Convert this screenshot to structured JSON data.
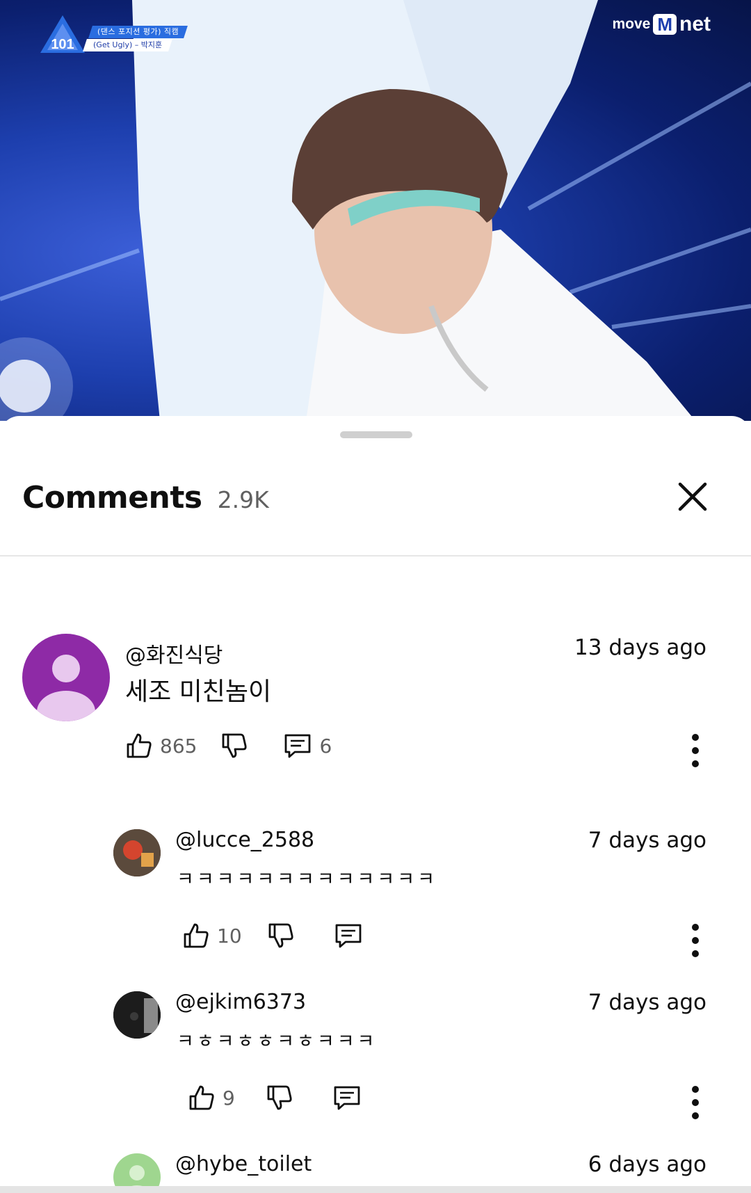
{
  "video": {
    "show_badge": "101",
    "caption_tag": "(댄스 포지션 평가) 직캠",
    "caption_sub": "(Get Ugly) – 박지훈",
    "brand_move": "move",
    "brand_m": "M",
    "brand_net": "net"
  },
  "comments_panel": {
    "title": "Comments",
    "count": "2.9K"
  },
  "comments": [
    {
      "user": "@화진식당",
      "time": "13 days ago",
      "text": "세조 미친놈이",
      "likes": "865",
      "replies": "6",
      "avatar_color": "#8e2aa6"
    },
    {
      "user": "@lucce_2588",
      "time": "7 days ago",
      "text": "ㅋㅋㅋㅋㅋㅋㅋㅋㅋㅋㅋㅋㅋ",
      "likes": "10",
      "replies": ""
    },
    {
      "user": "@ejkim6373",
      "time": "7 days ago",
      "text": "ㅋㅎㅋㅎㅎㅋㅎㅋㅋㅋ",
      "likes": "9",
      "replies": ""
    },
    {
      "user": "@hybe_toilet",
      "time": "6 days ago",
      "avatar_color": "#9fd68f"
    }
  ]
}
